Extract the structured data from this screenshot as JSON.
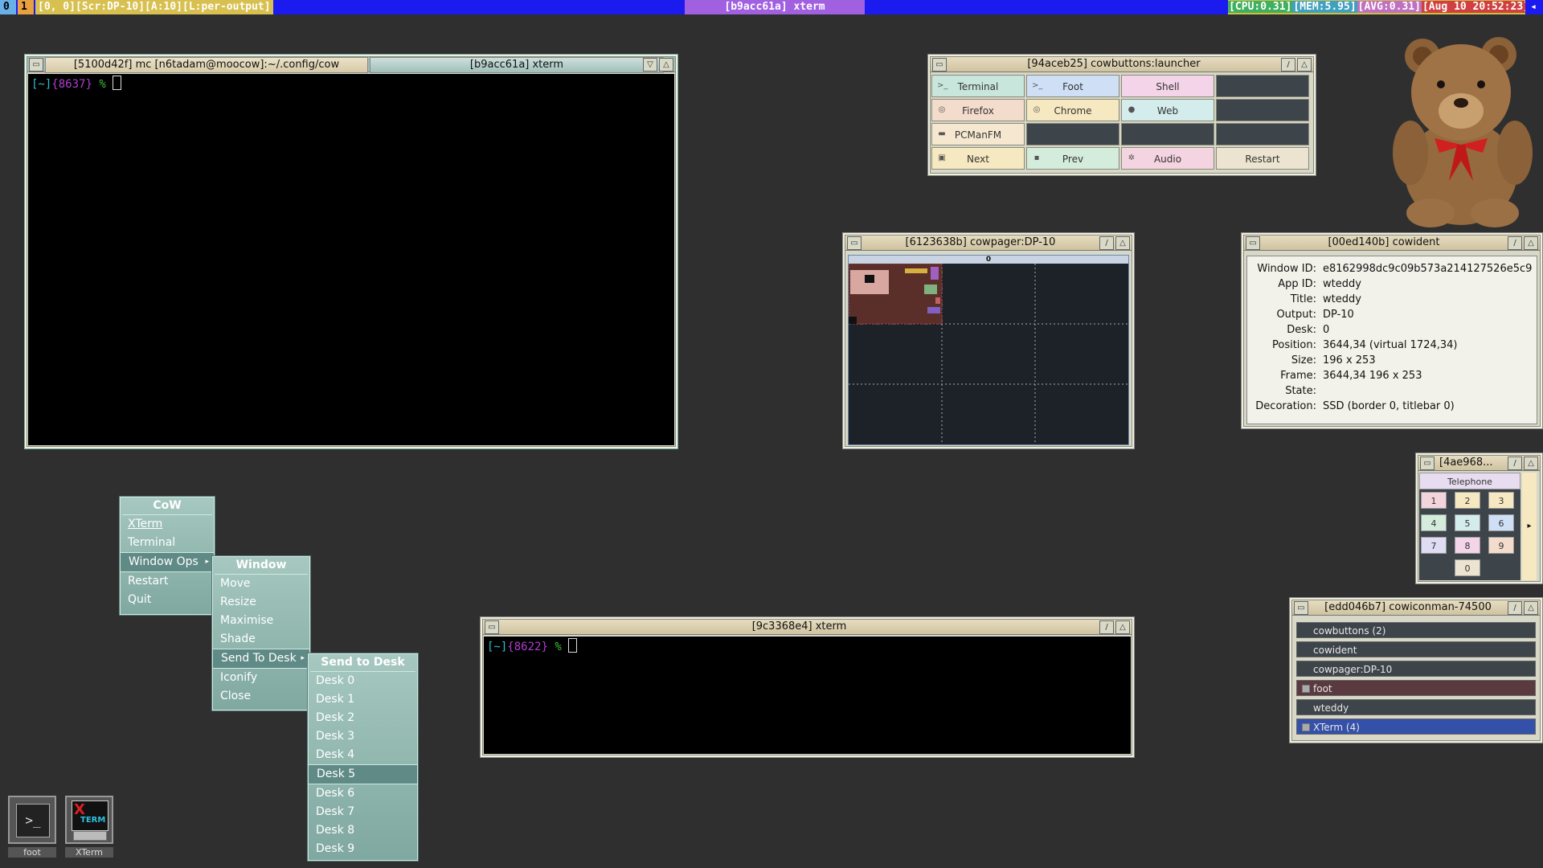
{
  "topbar": {
    "ws0": "0",
    "ws1": "1",
    "ws_info": "[0, 0][Scr:DP-10][A:10][L:per-output]",
    "title": "[b9acc61a] xterm",
    "cpu": "[CPU:0.31]",
    "mem": "[MEM:5.95]",
    "avg": "[AVG:0.31]",
    "clock": "[Aug 10 20:52:23]",
    "speaker": "◂"
  },
  "term1": {
    "tab1": "[5100d42f] mc [n6tadam@moocow]:~/.config/cow",
    "tab2": "[b9acc61a] xterm",
    "prompt_dir": "[~]",
    "prompt_pid": "{8637}",
    "prompt_sym": "%"
  },
  "launcher": {
    "title": "[94aceb25] cowbuttons:launcher",
    "buttons": [
      "Terminal",
      "Foot",
      "Shell",
      "Firefox",
      "Chrome",
      "Web",
      "PCManFM",
      "Next",
      "Prev",
      "Audio",
      "Restart"
    ],
    "colors": [
      "#c9e6dc",
      "#cfe0f6",
      "#f4d4e8",
      "#f4dccc",
      "#f6e8c0",
      "#d4ecec",
      "#f6e8d0",
      "#f6e8c0",
      "#d4ecdc",
      "#f4d4e0",
      "#ece4d0"
    ]
  },
  "pager": {
    "title": "[6123638b] cowpager:DP-10",
    "header": "0"
  },
  "widget": {
    "title": "[00ed140b] cowident",
    "rows": [
      {
        "k": "Window ID:",
        "v": "e8162998dc9c09b573a214127526e5c9"
      },
      {
        "k": "App ID:",
        "v": "wteddy"
      },
      {
        "k": "Title:",
        "v": "wteddy"
      },
      {
        "k": "Output:",
        "v": "DP-10"
      },
      {
        "k": "Desk:",
        "v": "0"
      },
      {
        "k": "Position:",
        "v": "3644,34  (virtual 1724,34)"
      },
      {
        "k": "Size:",
        "v": "196 x 253"
      },
      {
        "k": "Frame:",
        "v": "3644,34  196 x 253"
      },
      {
        "k": "State:",
        "v": ""
      },
      {
        "k": "Decoration:",
        "v": "SSD (border 0, titlebar 0)"
      }
    ]
  },
  "phone": {
    "title": "[4ae968...",
    "header": "Telephone",
    "keys": [
      "1",
      "2",
      "3",
      "4",
      "5",
      "6",
      "7",
      "8",
      "9",
      "0"
    ],
    "side_arrow": "▸"
  },
  "conman": {
    "title": "[edd046b7] cowiconman-74500",
    "items": [
      "cowbuttons (2)",
      "cowident",
      "cowpager:DP-10",
      "foot",
      "wteddy",
      "XTerm (4)"
    ]
  },
  "term2": {
    "title": "[9c3368e4] xterm",
    "prompt_dir": "[~]",
    "prompt_pid": "{8622}",
    "prompt_sym": "%"
  },
  "menu_cow": {
    "title": "CoW",
    "items": [
      "XTerm",
      "Terminal",
      "Window Ops",
      "Restart",
      "Quit"
    ],
    "hotkeys": [
      "X",
      "T",
      "W",
      "R",
      "Q"
    ]
  },
  "menu_window": {
    "title": "Window",
    "items": [
      "Move",
      "Resize",
      "Maximise",
      "Shade",
      "Send To Desk",
      "Iconify",
      "Close"
    ]
  },
  "menu_desk": {
    "title": "Send to Desk",
    "items": [
      "Desk 0",
      "Desk 1",
      "Desk 2",
      "Desk 3",
      "Desk 4",
      "Desk 5",
      "Desk 6",
      "Desk 7",
      "Desk 8",
      "Desk 9"
    ]
  },
  "dock": {
    "foot_label": "foot",
    "xterm_label": "XTerm",
    "xterm_icon_text": "TERM"
  },
  "win_buttons": {
    "menu": "▭",
    "shade": "▽",
    "max": "/",
    "min": "△"
  }
}
